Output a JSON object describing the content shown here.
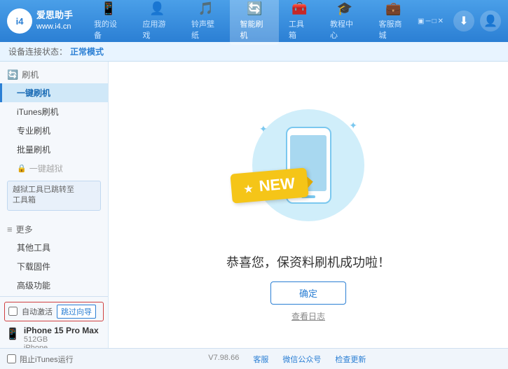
{
  "app": {
    "logo_icon": "i4",
    "logo_brand": "爱思助手",
    "logo_url": "www.i4.cn"
  },
  "nav": {
    "tabs": [
      {
        "label": "我的设备",
        "icon": "📱",
        "active": false
      },
      {
        "label": "应用游戏",
        "icon": "👤",
        "active": false
      },
      {
        "label": "铃声壁纸",
        "icon": "🎵",
        "active": false
      },
      {
        "label": "智能刷机",
        "icon": "🔄",
        "active": true
      },
      {
        "label": "工具箱",
        "icon": "🧰",
        "active": false
      },
      {
        "label": "教程中心",
        "icon": "🎓",
        "active": false
      },
      {
        "label": "客服商城",
        "icon": "💼",
        "active": false
      }
    ]
  },
  "sub_header": {
    "label": "设备连接状态：",
    "value": "正常模式"
  },
  "sidebar": {
    "sections": [
      {
        "type": "header",
        "icon": "🔄",
        "label": "刷机"
      },
      {
        "type": "item",
        "label": "一键刷机",
        "active": true
      },
      {
        "type": "item",
        "label": "iTunes刷机",
        "active": false
      },
      {
        "type": "item",
        "label": "专业刷机",
        "active": false
      },
      {
        "type": "item",
        "label": "批量刷机",
        "active": false
      },
      {
        "type": "disabled",
        "icon": "🔒",
        "label": "一键越狱"
      },
      {
        "type": "note",
        "text": "越狱工具已跳转至\n工具箱"
      }
    ],
    "more_section": {
      "header": "更多",
      "items": [
        "其他工具",
        "下载固件",
        "高级功能"
      ]
    }
  },
  "content": {
    "new_label": "NEW",
    "success_text": "恭喜您，保资料刷机成功啦！",
    "confirm_button": "确定",
    "log_link": "查看日志"
  },
  "footer": {
    "auto_activate_label": "自动激活",
    "guide_button": "跳过向导",
    "version": "V7.98.66",
    "links": [
      "客服",
      "微信公众号",
      "检查更新"
    ],
    "stop_itunes": "阻止iTunes运行"
  },
  "device": {
    "name": "iPhone 15 Pro Max",
    "storage": "512GB",
    "type": "iPhone"
  }
}
